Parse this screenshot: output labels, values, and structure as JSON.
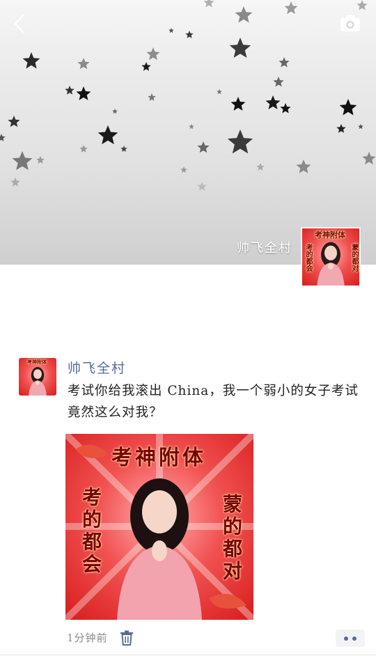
{
  "header": {
    "back_icon": "chevron-left-icon",
    "camera_icon": "camera-icon"
  },
  "cover": {
    "username": "帅飞全村",
    "avatar_banner_top": "考神附体",
    "avatar_banner_left": "考的都会",
    "avatar_banner_right": "蒙的都对"
  },
  "post": {
    "author": "帅飞全村",
    "text": "考试你给我滚出 China，我一个弱小的女子考试竟然这么对我？",
    "image": {
      "banner_top": "考神附体",
      "banner_left": "考的都会",
      "banner_right": "蒙的都对"
    },
    "time": "1分钟前",
    "delete_icon": "trash-icon",
    "more_icon": "more-dots-icon"
  },
  "colors": {
    "author_link": "#576b95",
    "art_background": "#e83030",
    "art_text": "#7a0000"
  }
}
